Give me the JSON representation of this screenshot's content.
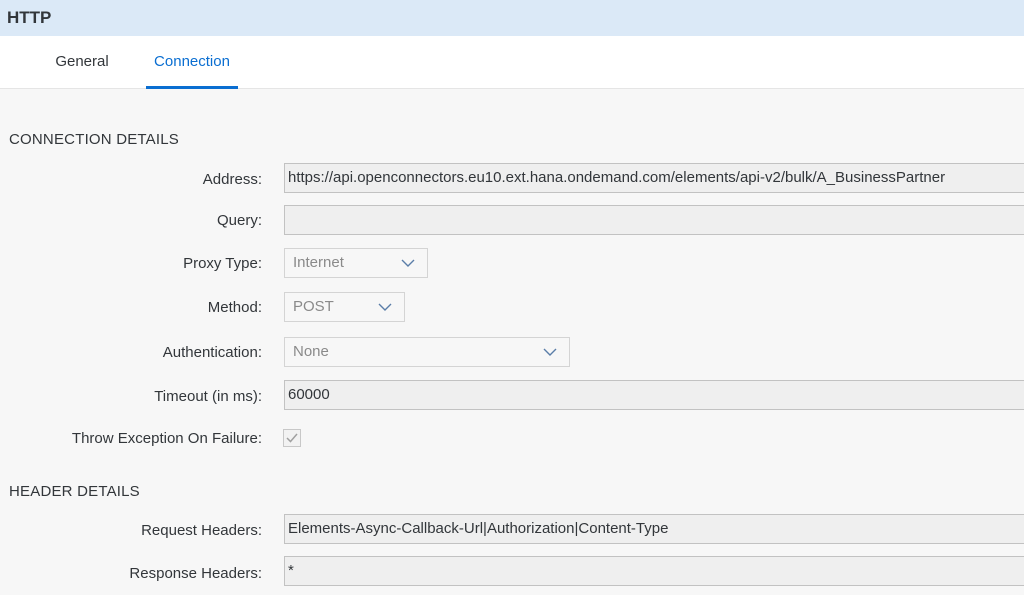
{
  "title": "HTTP",
  "tabs": [
    {
      "label": "General"
    },
    {
      "label": "Connection"
    }
  ],
  "connection_details": {
    "section_title": "CONNECTION DETAILS",
    "address": {
      "label": "Address:",
      "value": "https://api.openconnectors.eu10.ext.hana.ondemand.com/elements/api-v2/bulk/A_BusinessPartner"
    },
    "query": {
      "label": "Query:",
      "value": ""
    },
    "proxy_type": {
      "label": "Proxy Type:",
      "value": "Internet"
    },
    "method": {
      "label": "Method:",
      "value": "POST"
    },
    "authentication": {
      "label": "Authentication:",
      "value": "None"
    },
    "timeout": {
      "label": "Timeout (in ms):",
      "value": "60000"
    },
    "throw_exception": {
      "label": "Throw Exception On Failure:",
      "checked": true
    }
  },
  "header_details": {
    "section_title": "HEADER DETAILS",
    "request_headers": {
      "label": "Request Headers:",
      "value": "Elements-Async-Callback-Url|Authorization|Content-Type"
    },
    "response_headers": {
      "label": "Response Headers:",
      "value": "*"
    }
  },
  "icons": {
    "dropdown": "chevron-down-icon",
    "check": "checkmark-icon"
  },
  "colors": {
    "accent": "#0a6ed1",
    "header_bg": "#dbe9f7"
  }
}
